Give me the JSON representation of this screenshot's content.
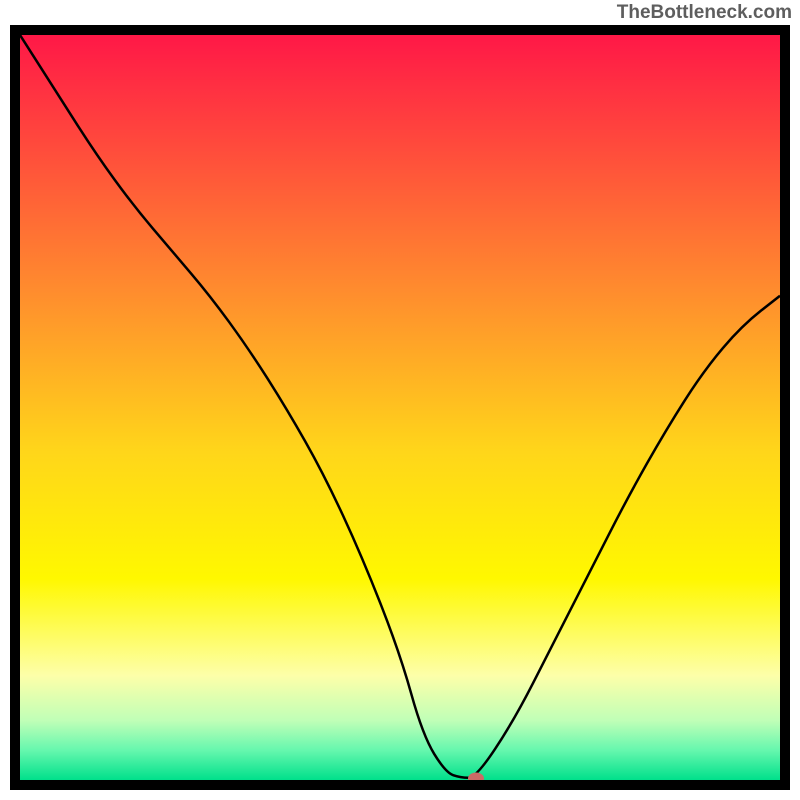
{
  "watermark": "TheBottleneck.com",
  "chart_data": {
    "type": "line",
    "title": "",
    "xlabel": "",
    "ylabel": "",
    "xlim": [
      0,
      100
    ],
    "ylim": [
      0,
      100
    ],
    "grid": false,
    "legend": false,
    "series": [
      {
        "name": "bottleneck-curve",
        "x": [
          0,
          5,
          10,
          15,
          20,
          25,
          30,
          35,
          40,
          45,
          50,
          53,
          56,
          58,
          60,
          65,
          70,
          75,
          80,
          85,
          90,
          95,
          100
        ],
        "y": [
          100,
          92,
          84,
          77,
          71,
          65,
          58,
          50,
          41,
          30,
          17,
          6,
          1,
          0.3,
          0.3,
          8,
          18,
          28,
          38,
          47,
          55,
          61,
          65
        ]
      }
    ],
    "marker": {
      "x": 60,
      "y": 0.2,
      "color": "#cc6b66"
    },
    "background_gradient": {
      "stops": [
        {
          "offset": 0.0,
          "color": "#ff1847"
        },
        {
          "offset": 0.34,
          "color": "#ff8b2e"
        },
        {
          "offset": 0.56,
          "color": "#ffd61a"
        },
        {
          "offset": 0.73,
          "color": "#fff800"
        },
        {
          "offset": 0.86,
          "color": "#fdffa9"
        },
        {
          "offset": 0.92,
          "color": "#c0ffb7"
        },
        {
          "offset": 0.96,
          "color": "#66f7ae"
        },
        {
          "offset": 1.0,
          "color": "#00e08b"
        }
      ]
    }
  }
}
